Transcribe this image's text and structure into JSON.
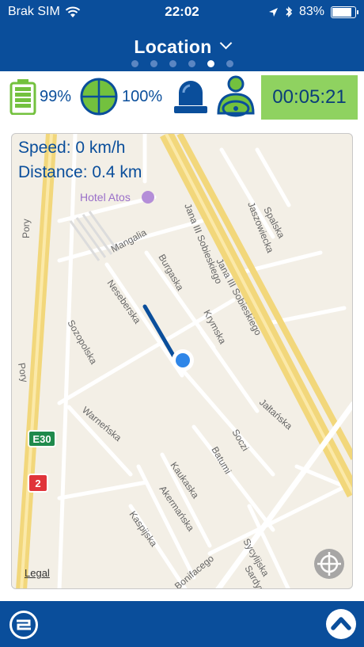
{
  "status_bar": {
    "carrier": "Brak SIM",
    "time": "22:02",
    "battery_percent": "83%"
  },
  "header": {
    "title": "Location",
    "page_dots": {
      "count": 6,
      "active_index": 4
    }
  },
  "indicators": {
    "battery_level": "99%",
    "gps_signal": "100%",
    "timer": "00:05:21"
  },
  "map": {
    "speed": "Speed: 0 km/h",
    "distance": "Distance: 0.4 km",
    "poi_hotel": "Hotel Atos",
    "legal": "Legal",
    "route_badge_e30": "E30",
    "route_badge_2": "2",
    "street_labels": [
      "Pory",
      "Mangalia",
      "Burgaska",
      "Neseberska",
      "Sozopolska",
      "Jana III Sobieskiego",
      "Jaszowiecka",
      "Spalska",
      "Krymska",
      "Jałtańska",
      "Warneńska",
      "Soczi",
      "Batumi",
      "Kaukaska",
      "Akermańska",
      "Kaspijska",
      "Sycylijska",
      "Sardyńska",
      "Bonifacego"
    ]
  },
  "colors": {
    "primary": "#0a4e9b",
    "timer_bg": "#8fd260",
    "map_bg": "#f3efe6",
    "highway": "#f2d77b"
  },
  "icons": {
    "battery": "battery-icon",
    "gps": "crosshair-target-icon",
    "beacon": "beacon-light-icon",
    "driver": "driver-icon",
    "locate": "locate-crosshair-icon",
    "logo": "app-logo-icon",
    "up": "chevron-up-icon"
  }
}
